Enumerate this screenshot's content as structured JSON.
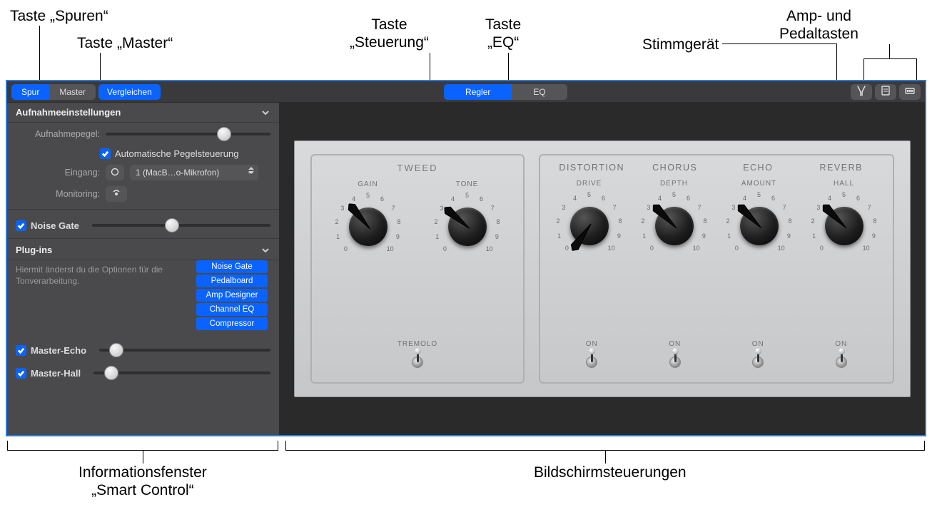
{
  "callouts": {
    "spuren": "Taste „Spuren“",
    "master": "Taste „Master“",
    "steuerung": "Taste\n„Steuerung“",
    "eq": "Taste\n„EQ“",
    "stimm": "Stimmgerät",
    "amp_pedal": "Amp- und\nPedaltasten",
    "info_panel": "Informationsfenster\n„Smart Control“",
    "screen_controls": "Bildschirmsteuerungen"
  },
  "toolbar": {
    "spur": "Spur",
    "master": "Master",
    "vergleichen": "Vergleichen",
    "regler": "Regler",
    "eq": "EQ"
  },
  "inspector": {
    "rec_settings": "Aufnahmeeinstellungen",
    "rec_level": "Aufnahmepegel:",
    "auto_level": "Automatische Pegelsteuerung",
    "input": "Eingang:",
    "input_value": "1 (MacB…o-Mikrofon)",
    "monitoring": "Monitoring:",
    "noise_gate": "Noise Gate",
    "plugins": "Plug-ins",
    "plugins_desc": "Hiermit änderst du die Optionen für die Tonverarbeitung.",
    "plugin_list": [
      "Noise Gate",
      "Pedalboard",
      "Amp Designer",
      "Channel EQ",
      "Compressor"
    ],
    "master_echo": "Master-Echo",
    "master_hall": "Master-Hall"
  },
  "amp": {
    "left_title": "TWEED",
    "left_knobs": [
      {
        "label": "GAIN",
        "angle": 130
      },
      {
        "label": "TONE",
        "angle": 140
      }
    ],
    "left_toggle": "TREMOLO",
    "right_columns": [
      "DISTORTION",
      "CHORUS",
      "ECHO",
      "REVERB"
    ],
    "right_knobs": [
      {
        "label": "DRIVE",
        "angle": 235
      },
      {
        "label": "DEPTH",
        "angle": 135
      },
      {
        "label": "AMOUNT",
        "angle": 135
      },
      {
        "label": "HALL",
        "angle": 135
      }
    ],
    "right_toggle": "ON",
    "scale": [
      "0",
      "1",
      "2",
      "3",
      "4",
      "5",
      "6",
      "7",
      "8",
      "9",
      "10"
    ]
  },
  "colors": {
    "accent": "#0a63ff"
  }
}
